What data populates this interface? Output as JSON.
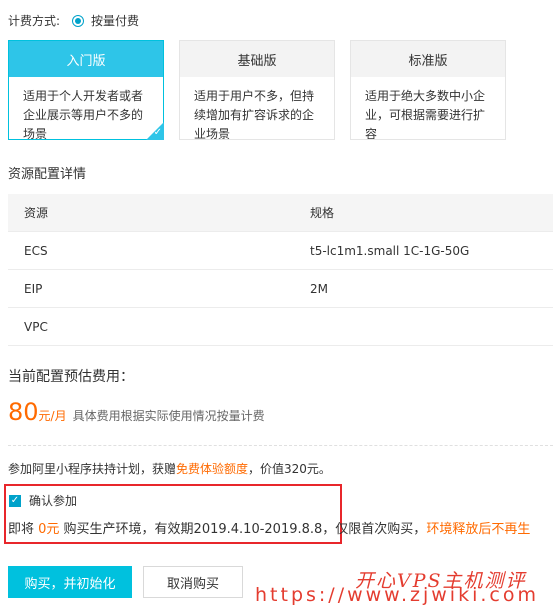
{
  "billing": {
    "label": "计费方式:",
    "option": "按量付费"
  },
  "plans": [
    {
      "name": "入门版",
      "desc": "适用于个人开发者或者企业展示等用户不多的场景",
      "selected": true
    },
    {
      "name": "基础版",
      "desc": "适用于用户不多，但持续增加有扩容诉求的企业场景",
      "selected": false
    },
    {
      "name": "标准版",
      "desc": "适用于绝大多数中小企业，可根据需要进行扩容",
      "selected": false
    }
  ],
  "resource_section": {
    "title": "资源配置详情",
    "headers": {
      "resource": "资源",
      "spec": "规格"
    },
    "rows": [
      {
        "resource": "ECS",
        "spec": "t5-lc1m1.small 1C-1G-50G"
      },
      {
        "resource": "EIP",
        "spec": "2M"
      },
      {
        "resource": "VPC",
        "spec": ""
      }
    ]
  },
  "estimate": {
    "title": "当前配置预估费用：",
    "amount": "80",
    "unit": "元/月",
    "note": "具体费用根据实际使用情况按量计费"
  },
  "promo": {
    "prefix": "参加阿里小程序扶持计划，获赠",
    "highlight": "免费体验额度",
    "suffix": "，价值320元。"
  },
  "confirm": {
    "label": "确认参加",
    "checked": true
  },
  "offer": {
    "prefix": "即将 ",
    "price": "0元",
    "middle": " 购买生产环境，有效期2019.4.10-2019.8.8，仅限首次购买，",
    "warning": "环境释放后不再生"
  },
  "buttons": {
    "primary": "购买，并初始化",
    "secondary": "取消购买"
  },
  "watermark": {
    "brand": "开心VPS主机测评",
    "url": "https://www.zjwiki.com"
  },
  "colors": {
    "accent": "#00c1de",
    "price": "#ff6a00",
    "highlight_box": "#e8262b",
    "watermark": "#e43c2f"
  }
}
